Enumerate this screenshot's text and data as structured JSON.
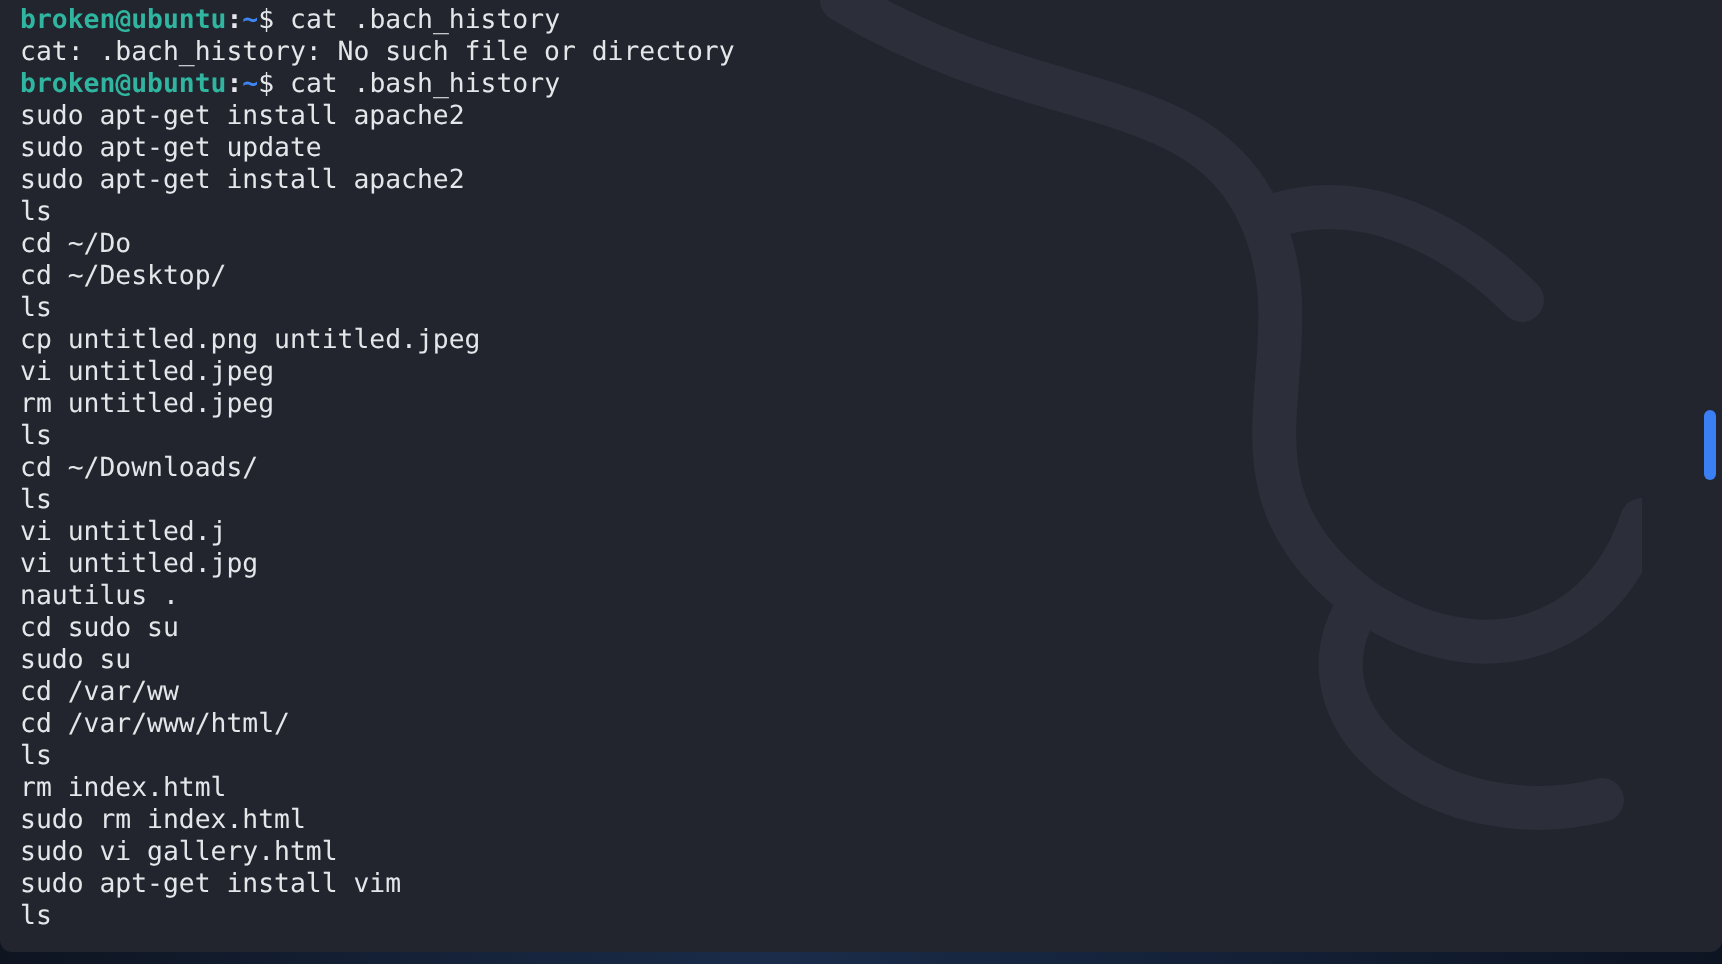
{
  "terminal": {
    "lines": [
      {
        "kind": "prompt",
        "user": "broken@ubuntu",
        "separator": ":",
        "path": "~",
        "symbol": "$",
        "command": "cat .bach_history"
      },
      {
        "kind": "output",
        "text": "cat: .bach_history: No such file or directory"
      },
      {
        "kind": "prompt",
        "user": "broken@ubuntu",
        "separator": ":",
        "path": "~",
        "symbol": "$",
        "command": "cat .bash_history"
      },
      {
        "kind": "output",
        "text": "sudo apt-get install apache2"
      },
      {
        "kind": "output",
        "text": "sudo apt-get update"
      },
      {
        "kind": "output",
        "text": "sudo apt-get install apache2"
      },
      {
        "kind": "output",
        "text": "ls"
      },
      {
        "kind": "output",
        "text": "cd ~/Do"
      },
      {
        "kind": "output",
        "text": "cd ~/Desktop/"
      },
      {
        "kind": "output",
        "text": "ls"
      },
      {
        "kind": "output",
        "text": "cp untitled.png untitled.jpeg"
      },
      {
        "kind": "output",
        "text": "vi untitled.jpeg"
      },
      {
        "kind": "output",
        "text": "rm untitled.jpeg"
      },
      {
        "kind": "output",
        "text": "ls"
      },
      {
        "kind": "output",
        "text": "cd ~/Downloads/"
      },
      {
        "kind": "output",
        "text": "ls"
      },
      {
        "kind": "output",
        "text": "vi untitled.j"
      },
      {
        "kind": "output",
        "text": "vi untitled.jpg"
      },
      {
        "kind": "output",
        "text": "nautilus ."
      },
      {
        "kind": "output",
        "text": "cd sudo su"
      },
      {
        "kind": "output",
        "text": "sudo su"
      },
      {
        "kind": "output",
        "text": "cd /var/ww"
      },
      {
        "kind": "output",
        "text": "cd /var/www/html/"
      },
      {
        "kind": "output",
        "text": "ls"
      },
      {
        "kind": "output",
        "text": "rm index.html"
      },
      {
        "kind": "output",
        "text": "sudo rm index.html"
      },
      {
        "kind": "output",
        "text": "sudo vi gallery.html"
      },
      {
        "kind": "output",
        "text": "sudo apt-get install vim"
      },
      {
        "kind": "output",
        "text": "ls"
      }
    ]
  }
}
